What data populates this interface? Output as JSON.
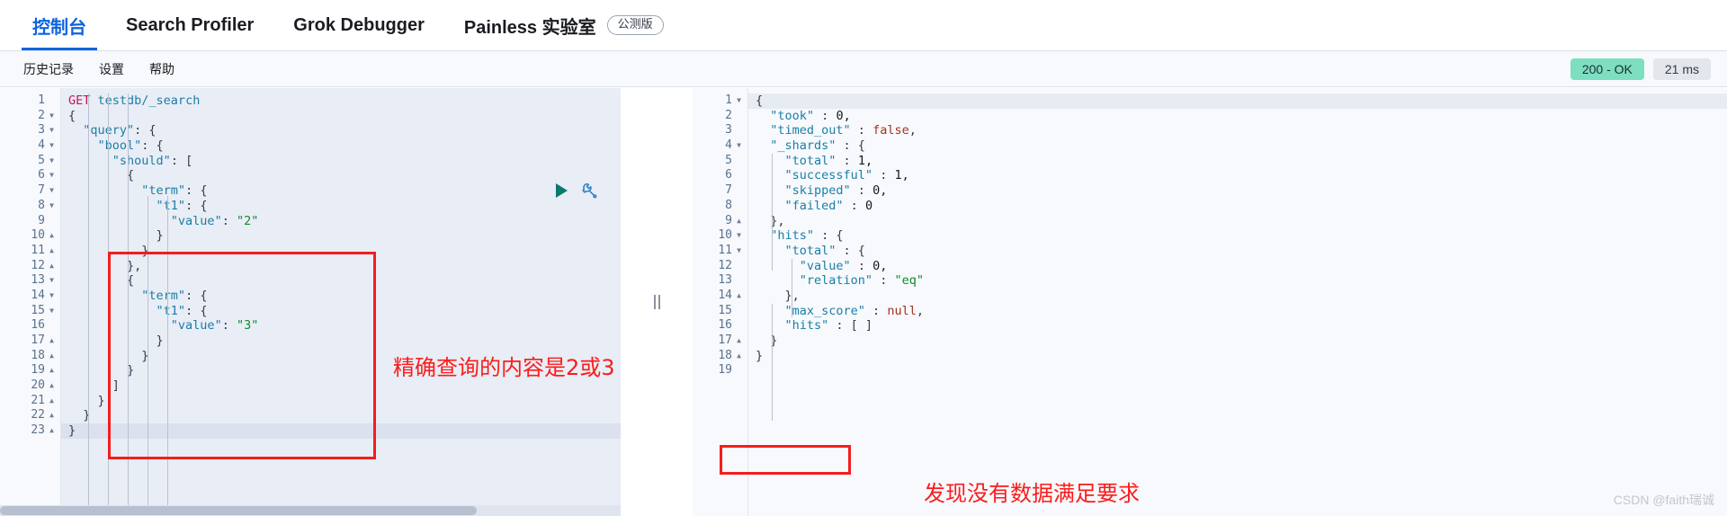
{
  "topnav": {
    "items": [
      {
        "label": "控制台",
        "active": true,
        "pill": null
      },
      {
        "label": "Search Profiler",
        "active": false,
        "pill": null
      },
      {
        "label": "Grok Debugger",
        "active": false,
        "pill": null
      },
      {
        "label": "Painless 实验室",
        "active": false,
        "pill": "公测版"
      }
    ]
  },
  "subbar": {
    "items": [
      {
        "label": "历史记录"
      },
      {
        "label": "设置"
      },
      {
        "label": "帮助"
      }
    ],
    "status_code": "200 - OK",
    "status_time": "21 ms"
  },
  "actions": {
    "run_label": "play-icon",
    "wrench_label": "wrench-icon"
  },
  "request_editor": {
    "lines": [
      {
        "n": 1,
        "fold": "",
        "tokens": [
          {
            "c": "t-meth",
            "t": "GET"
          },
          {
            "c": "t-punc",
            "t": " "
          },
          {
            "c": "t-url",
            "t": "testdb/_search"
          }
        ]
      },
      {
        "n": 2,
        "fold": "v",
        "tokens": [
          {
            "c": "t-punc",
            "t": "{"
          }
        ]
      },
      {
        "n": 3,
        "fold": "v",
        "tokens": [
          {
            "c": "t-punc",
            "t": "  "
          },
          {
            "c": "t-key",
            "t": "\"query\""
          },
          {
            "c": "t-punc",
            "t": ": {"
          }
        ]
      },
      {
        "n": 4,
        "fold": "v",
        "tokens": [
          {
            "c": "t-punc",
            "t": "    "
          },
          {
            "c": "t-key",
            "t": "\"bool\""
          },
          {
            "c": "t-punc",
            "t": ": {"
          }
        ]
      },
      {
        "n": 5,
        "fold": "v",
        "tokens": [
          {
            "c": "t-punc",
            "t": "      "
          },
          {
            "c": "t-key",
            "t": "\"should\""
          },
          {
            "c": "t-punc",
            "t": ": ["
          }
        ]
      },
      {
        "n": 6,
        "fold": "v",
        "tokens": [
          {
            "c": "t-punc",
            "t": "        {"
          }
        ]
      },
      {
        "n": 7,
        "fold": "v",
        "tokens": [
          {
            "c": "t-punc",
            "t": "          "
          },
          {
            "c": "t-key",
            "t": "\"term\""
          },
          {
            "c": "t-punc",
            "t": ": {"
          }
        ]
      },
      {
        "n": 8,
        "fold": "v",
        "tokens": [
          {
            "c": "t-punc",
            "t": "            "
          },
          {
            "c": "t-key",
            "t": "\"t1\""
          },
          {
            "c": "t-punc",
            "t": ": {"
          }
        ]
      },
      {
        "n": 9,
        "fold": "",
        "tokens": [
          {
            "c": "t-punc",
            "t": "              "
          },
          {
            "c": "t-key",
            "t": "\"value\""
          },
          {
            "c": "t-punc",
            "t": ": "
          },
          {
            "c": "t-str",
            "t": "\"2\""
          }
        ]
      },
      {
        "n": 10,
        "fold": "^",
        "tokens": [
          {
            "c": "t-punc",
            "t": "            }"
          }
        ]
      },
      {
        "n": 11,
        "fold": "^",
        "tokens": [
          {
            "c": "t-punc",
            "t": "          }"
          }
        ]
      },
      {
        "n": 12,
        "fold": "^",
        "tokens": [
          {
            "c": "t-punc",
            "t": "        },"
          }
        ]
      },
      {
        "n": 13,
        "fold": "v",
        "tokens": [
          {
            "c": "t-punc",
            "t": "        {"
          }
        ]
      },
      {
        "n": 14,
        "fold": "v",
        "tokens": [
          {
            "c": "t-punc",
            "t": "          "
          },
          {
            "c": "t-key",
            "t": "\"term\""
          },
          {
            "c": "t-punc",
            "t": ": {"
          }
        ]
      },
      {
        "n": 15,
        "fold": "v",
        "tokens": [
          {
            "c": "t-punc",
            "t": "            "
          },
          {
            "c": "t-key",
            "t": "\"t1\""
          },
          {
            "c": "t-punc",
            "t": ": {"
          }
        ]
      },
      {
        "n": 16,
        "fold": "",
        "tokens": [
          {
            "c": "t-punc",
            "t": "              "
          },
          {
            "c": "t-key",
            "t": "\"value\""
          },
          {
            "c": "t-punc",
            "t": ": "
          },
          {
            "c": "t-str",
            "t": "\"3\""
          }
        ]
      },
      {
        "n": 17,
        "fold": "^",
        "tokens": [
          {
            "c": "t-punc",
            "t": "            }"
          }
        ]
      },
      {
        "n": 18,
        "fold": "^",
        "tokens": [
          {
            "c": "t-punc",
            "t": "          }"
          }
        ]
      },
      {
        "n": 19,
        "fold": "^",
        "tokens": [
          {
            "c": "t-punc",
            "t": "        }"
          }
        ]
      },
      {
        "n": 20,
        "fold": "^",
        "tokens": [
          {
            "c": "t-punc",
            "t": "      ]"
          }
        ]
      },
      {
        "n": 21,
        "fold": "^",
        "tokens": [
          {
            "c": "t-punc",
            "t": "    }"
          }
        ]
      },
      {
        "n": 22,
        "fold": "^",
        "tokens": [
          {
            "c": "t-punc",
            "t": "  }"
          }
        ]
      },
      {
        "n": 23,
        "fold": "^",
        "hl": true,
        "tokens": [
          {
            "c": "t-punc",
            "t": "}"
          }
        ]
      }
    ]
  },
  "response_viewer": {
    "lines": [
      {
        "n": 1,
        "fold": "v",
        "hl": true,
        "tokens": [
          {
            "c": "t-punc",
            "t": "{"
          }
        ]
      },
      {
        "n": 2,
        "fold": "",
        "tokens": [
          {
            "c": "t-punc",
            "t": "  "
          },
          {
            "c": "t-key",
            "t": "\"took\""
          },
          {
            "c": "t-punc",
            "t": " : "
          },
          {
            "c": "t-num",
            "t": "0,"
          }
        ]
      },
      {
        "n": 3,
        "fold": "",
        "tokens": [
          {
            "c": "t-punc",
            "t": "  "
          },
          {
            "c": "t-key",
            "t": "\"timed_out\""
          },
          {
            "c": "t-punc",
            "t": " : "
          },
          {
            "c": "t-bool",
            "t": "false"
          },
          {
            "c": "t-punc",
            "t": ","
          }
        ]
      },
      {
        "n": 4,
        "fold": "v",
        "tokens": [
          {
            "c": "t-punc",
            "t": "  "
          },
          {
            "c": "t-key",
            "t": "\"_shards\""
          },
          {
            "c": "t-punc",
            "t": " : {"
          }
        ]
      },
      {
        "n": 5,
        "fold": "",
        "tokens": [
          {
            "c": "t-punc",
            "t": "    "
          },
          {
            "c": "t-key",
            "t": "\"total\""
          },
          {
            "c": "t-punc",
            "t": " : "
          },
          {
            "c": "t-num",
            "t": "1,"
          }
        ]
      },
      {
        "n": 6,
        "fold": "",
        "tokens": [
          {
            "c": "t-punc",
            "t": "    "
          },
          {
            "c": "t-key",
            "t": "\"successful\""
          },
          {
            "c": "t-punc",
            "t": " : "
          },
          {
            "c": "t-num",
            "t": "1,"
          }
        ]
      },
      {
        "n": 7,
        "fold": "",
        "tokens": [
          {
            "c": "t-punc",
            "t": "    "
          },
          {
            "c": "t-key",
            "t": "\"skipped\""
          },
          {
            "c": "t-punc",
            "t": " : "
          },
          {
            "c": "t-num",
            "t": "0,"
          }
        ]
      },
      {
        "n": 8,
        "fold": "",
        "tokens": [
          {
            "c": "t-punc",
            "t": "    "
          },
          {
            "c": "t-key",
            "t": "\"failed\""
          },
          {
            "c": "t-punc",
            "t": " : "
          },
          {
            "c": "t-num",
            "t": "0"
          }
        ]
      },
      {
        "n": 9,
        "fold": "^",
        "tokens": [
          {
            "c": "t-punc",
            "t": "  },"
          }
        ]
      },
      {
        "n": 10,
        "fold": "v",
        "tokens": [
          {
            "c": "t-punc",
            "t": "  "
          },
          {
            "c": "t-key",
            "t": "\"hits\""
          },
          {
            "c": "t-punc",
            "t": " : {"
          }
        ]
      },
      {
        "n": 11,
        "fold": "v",
        "tokens": [
          {
            "c": "t-punc",
            "t": "    "
          },
          {
            "c": "t-key",
            "t": "\"total\""
          },
          {
            "c": "t-punc",
            "t": " : {"
          }
        ]
      },
      {
        "n": 12,
        "fold": "",
        "tokens": [
          {
            "c": "t-punc",
            "t": "      "
          },
          {
            "c": "t-key",
            "t": "\"value\""
          },
          {
            "c": "t-punc",
            "t": " : "
          },
          {
            "c": "t-num",
            "t": "0,"
          }
        ]
      },
      {
        "n": 13,
        "fold": "",
        "tokens": [
          {
            "c": "t-punc",
            "t": "      "
          },
          {
            "c": "t-key",
            "t": "\"relation\""
          },
          {
            "c": "t-punc",
            "t": " : "
          },
          {
            "c": "t-str",
            "t": "\"eq\""
          }
        ]
      },
      {
        "n": 14,
        "fold": "^",
        "tokens": [
          {
            "c": "t-punc",
            "t": "    },"
          }
        ]
      },
      {
        "n": 15,
        "fold": "",
        "tokens": [
          {
            "c": "t-punc",
            "t": "    "
          },
          {
            "c": "t-key",
            "t": "\"max_score\""
          },
          {
            "c": "t-punc",
            "t": " : "
          },
          {
            "c": "t-null",
            "t": "null"
          },
          {
            "c": "t-punc",
            "t": ","
          }
        ]
      },
      {
        "n": 16,
        "fold": "",
        "tokens": [
          {
            "c": "t-punc",
            "t": "    "
          },
          {
            "c": "t-key",
            "t": "\"hits\""
          },
          {
            "c": "t-punc",
            "t": " : [ ]"
          }
        ]
      },
      {
        "n": 17,
        "fold": "^",
        "tokens": [
          {
            "c": "t-punc",
            "t": "  }"
          }
        ]
      },
      {
        "n": 18,
        "fold": "^",
        "tokens": [
          {
            "c": "t-punc",
            "t": "}"
          }
        ]
      },
      {
        "n": 19,
        "fold": "",
        "tokens": []
      }
    ]
  },
  "annotations": {
    "left_note": "精确查询的内容是2或3",
    "right_note": "发现没有数据满足要求",
    "box_color": "#f41d1d",
    "text_color": "#fb1c1c"
  },
  "watermark": "CSDN @faith瑞诚"
}
